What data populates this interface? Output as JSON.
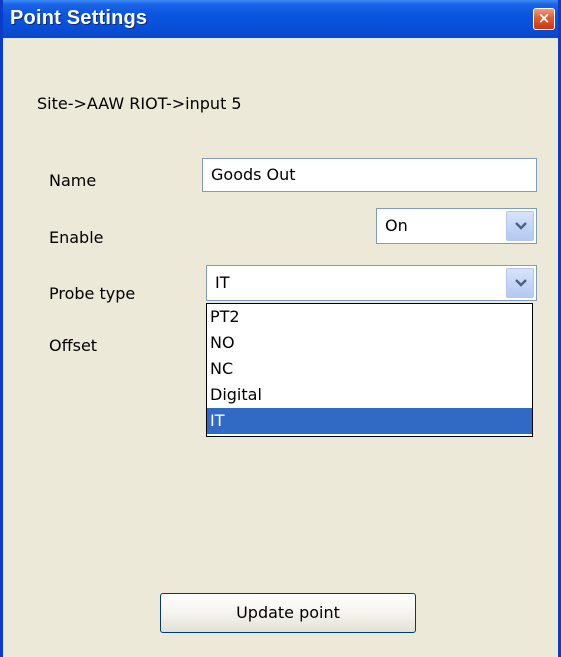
{
  "window": {
    "title": "Point Settings",
    "close_glyph": "×"
  },
  "breadcrumb": "Site->AAW RIOT->input 5",
  "fields": {
    "name_label": "Name",
    "name_value": "Goods Out",
    "enable_label": "Enable",
    "enable_value": "On",
    "probe_label": "Probe type",
    "probe_value": "IT",
    "offset_label": "Offset"
  },
  "probe_options": [
    "PT2",
    "NO",
    "NC",
    "Digital",
    "IT"
  ],
  "probe_selected_index": 4,
  "update_button": "Update point",
  "colors": {
    "titlebar": "#0a55df",
    "selection": "#316ac5",
    "face": "#ece9d8"
  }
}
